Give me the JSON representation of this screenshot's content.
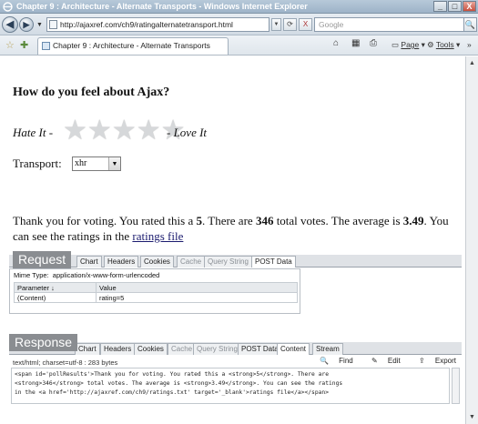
{
  "window": {
    "title": "Chapter 9 : Architecture - Alternate Transports - Windows Internet Explorer",
    "min_label": "_",
    "max_label": "□",
    "close_label": "X"
  },
  "address_bar": {
    "back_label": "◀",
    "forward_label": "▶",
    "url": "http://ajaxref.com/ch9/ratingalternatetransport.html",
    "search_placeholder": "Google",
    "refresh_label": "⟳",
    "stop_label": "X",
    "search_go_label": "🔍"
  },
  "fav_bar": {
    "tab_title": "Chapter 9 : Architecture - Alternate Transports",
    "home_label": "⌂",
    "feeds_label": "▦",
    "print_label": "⎙",
    "page_label": "Page",
    "tools_label": "Tools",
    "more_label": "»"
  },
  "page": {
    "question": "How do you feel about Ajax?",
    "hate_label": "Hate It -",
    "love_label": "- Love It",
    "stars": [
      "★",
      "★",
      "★",
      "★",
      "★"
    ],
    "transport_label": "Transport:",
    "transport_value": "xhr",
    "result_prefix": "Thank you for voting. You rated this a ",
    "rating": "5",
    "result_mid1": ". There are ",
    "total_votes": "346",
    "result_mid2": " total votes. The average is ",
    "average": "3.49",
    "result_mid3": ". You can see the ratings in the ",
    "ratings_link": "ratings file"
  },
  "request_panel": {
    "label": "Request",
    "tabs": [
      "Chart",
      "Headers",
      "Cookies",
      "Cache",
      "Query String",
      "POST Data"
    ],
    "mime_label": "Mime Type:",
    "mime_value": "application/x-www-form-urlencoded",
    "col_param": "Parameter",
    "col_value": "Value",
    "row_param": "(Content)",
    "row_value": "rating=5"
  },
  "response_panel": {
    "label": "Response",
    "tabs": [
      "Chart",
      "Headers",
      "Cookies",
      "Cache",
      "Query String",
      "POST Data",
      "Content",
      "Stream"
    ],
    "content_type": "text/html; charset=utf-8 : 283 bytes",
    "find_label": "Find",
    "edit_label": "Edit",
    "export_label": "Export",
    "code_lines": [
      "<span id='pollResults'>Thank you for voting.  You rated this a <strong>5</strong>.  There are",
      "<strong>346</strong> total votes.  The average is <strong>3.49</strong>.  You can see the ratings",
      "in the <a href='http://ajaxref.com/ch9/ratings.txt' target='_blank'>ratings file</a></span>"
    ]
  }
}
